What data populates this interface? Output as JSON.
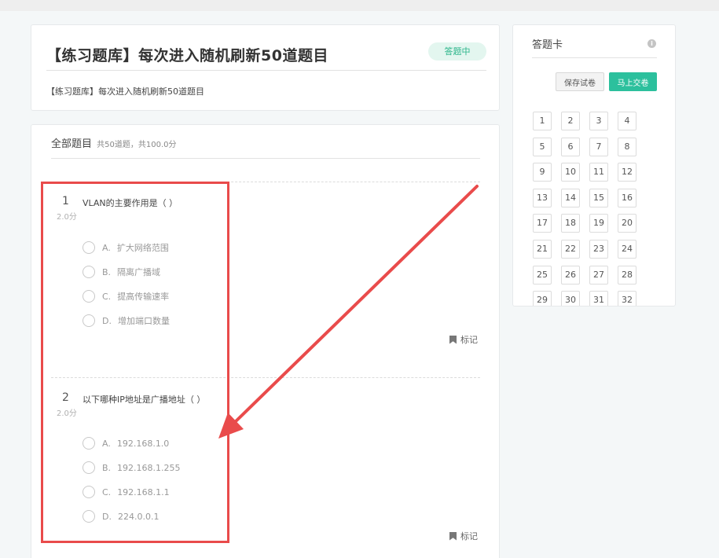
{
  "header": {
    "title": "【练习题库】每次进入随机刷新50道题目",
    "status": "答题中",
    "subtitle": "【练习题库】每次进入随机刷新50道题目"
  },
  "main": {
    "section_title": "全部题目",
    "section_meta": "共50道题，共100.0分",
    "mark_label": "标记",
    "questions": [
      {
        "number": "1",
        "score": "2.0分",
        "text": "VLAN的主要作用是（ ）",
        "options": [
          {
            "letter": "A.",
            "text": "扩大网络范围"
          },
          {
            "letter": "B.",
            "text": "隔离广播域"
          },
          {
            "letter": "C.",
            "text": "提高传输速率"
          },
          {
            "letter": "D.",
            "text": "增加端口数量"
          }
        ]
      },
      {
        "number": "2",
        "score": "2.0分",
        "text": "以下哪种IP地址是广播地址（ ）",
        "options": [
          {
            "letter": "A.",
            "text": "192.168.1.0"
          },
          {
            "letter": "B.",
            "text": "192.168.1.255"
          },
          {
            "letter": "C.",
            "text": "192.168.1.1"
          },
          {
            "letter": "D.",
            "text": "224.0.0.1"
          }
        ]
      }
    ]
  },
  "sheet": {
    "title": "答题卡",
    "info_icon": "info-icon",
    "save_label": "保存试卷",
    "submit_label": "马上交卷",
    "numbers": [
      "1",
      "2",
      "3",
      "4",
      "5",
      "6",
      "7",
      "8",
      "9",
      "10",
      "11",
      "12",
      "13",
      "14",
      "15",
      "16",
      "17",
      "18",
      "19",
      "20",
      "21",
      "22",
      "23",
      "24",
      "25",
      "26",
      "27",
      "28",
      "29",
      "30",
      "31",
      "32"
    ]
  },
  "colors": {
    "accent": "#2cc09d",
    "status_bg": "#e3f6ef",
    "annotation": "#e94b4b"
  }
}
